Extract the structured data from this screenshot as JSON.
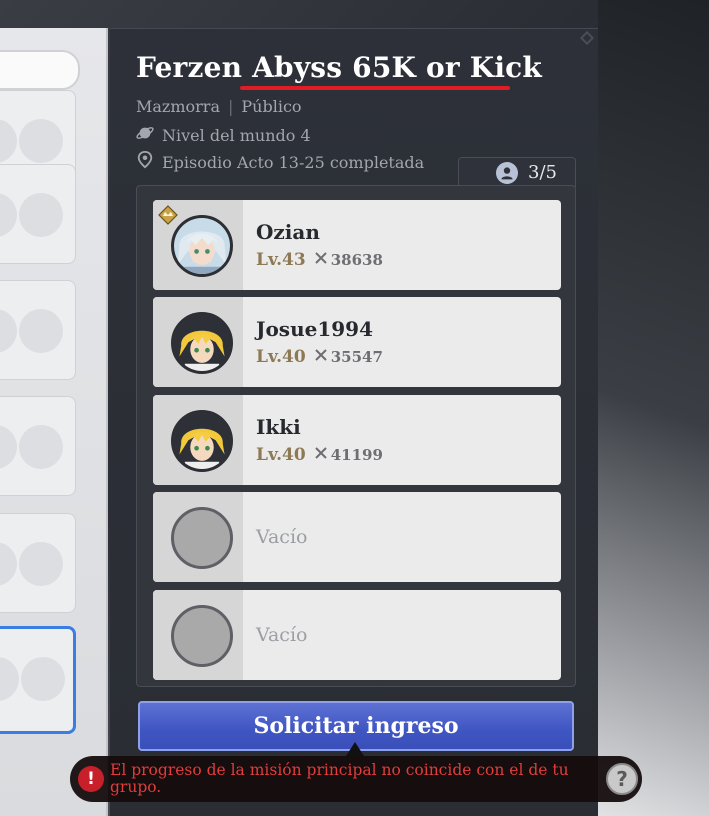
{
  "room": {
    "title": "Ferzen Abyss 65K or Kick",
    "type": "Mazmorra",
    "visibility": "Público",
    "world_level": "Nivel del mundo 4",
    "episode": "Episodio Acto 13-25 completada"
  },
  "party": {
    "count": "3/5",
    "members": [
      {
        "name": "Ozian",
        "level": "Lv.43",
        "power": "38638",
        "leader": true,
        "avatar": "white-hair-character"
      },
      {
        "name": "Josue1994",
        "level": "Lv.40",
        "power": "35547",
        "leader": false,
        "avatar": "blonde-hair-character"
      },
      {
        "name": "Ikki",
        "level": "Lv.40",
        "power": "41199",
        "leader": false,
        "avatar": "blonde-hair-character"
      }
    ],
    "empty_label_1": "Vacío",
    "empty_label_2": "Vacío"
  },
  "actions": {
    "request_label": "Solicitar ingreso"
  },
  "toast": {
    "message": "El progreso de la misión principal no coincide con el de tu grupo.",
    "help_label": "?",
    "warn_label": "!"
  },
  "colors": {
    "accent_button": "#4a5fc8",
    "warning_text": "#e33c3c",
    "title_underline": "#e01c24"
  }
}
